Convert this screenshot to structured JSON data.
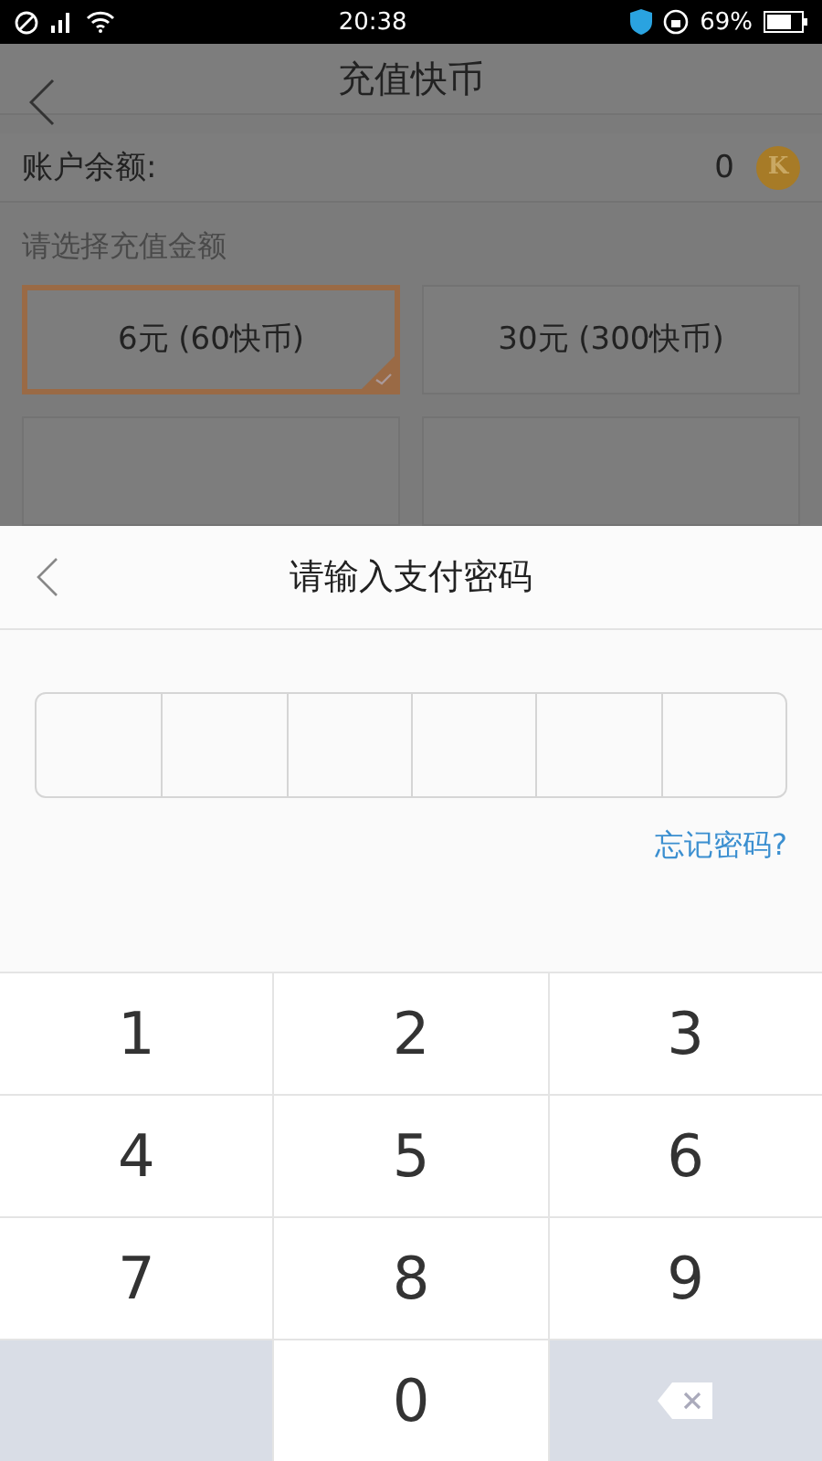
{
  "status_bar": {
    "time": "20:38",
    "battery_text": "69%"
  },
  "header": {
    "title": "充值快币"
  },
  "balance": {
    "label": "账户余额:",
    "value": "0",
    "coin": "K"
  },
  "amount_section": {
    "label": "请选择充值金额",
    "options": [
      {
        "label": "6元 (60快币)",
        "selected": true
      },
      {
        "label": "30元 (300快币)",
        "selected": false
      }
    ]
  },
  "payment_sheet": {
    "title": "请输入支付密码",
    "digits": [
      {
        "filled": false
      },
      {
        "filled": false
      },
      {
        "filled": false
      },
      {
        "filled": false
      },
      {
        "filled": false
      },
      {
        "filled": false
      }
    ],
    "forgot_link": "忘记密码?"
  },
  "keypad": [
    {
      "kind": "digit",
      "label": "1"
    },
    {
      "kind": "digit",
      "label": "2"
    },
    {
      "kind": "digit",
      "label": "3"
    },
    {
      "kind": "digit",
      "label": "4"
    },
    {
      "kind": "digit",
      "label": "5"
    },
    {
      "kind": "digit",
      "label": "6"
    },
    {
      "kind": "digit",
      "label": "7"
    },
    {
      "kind": "digit",
      "label": "8"
    },
    {
      "kind": "digit",
      "label": "9"
    },
    {
      "kind": "blank"
    },
    {
      "kind": "digit",
      "label": "0"
    },
    {
      "kind": "backspace"
    }
  ]
}
